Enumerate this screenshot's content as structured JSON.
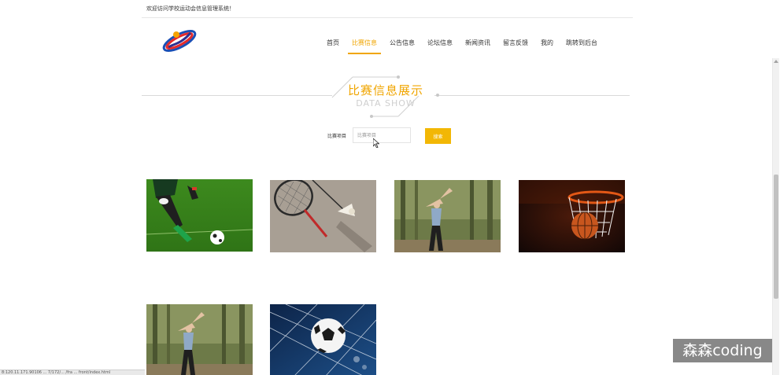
{
  "header": {
    "welcome_text": "欢迎访问学校运动会信息管理系统！"
  },
  "nav": {
    "items": [
      {
        "label": "首页"
      },
      {
        "label": "比赛信息",
        "active": true
      },
      {
        "label": "公告信息"
      },
      {
        "label": "论坛信息"
      },
      {
        "label": "新闻资讯"
      },
      {
        "label": "留言反馈"
      },
      {
        "label": "我的"
      },
      {
        "label": "跳转到后台"
      }
    ],
    "accent_color": "#f0a500"
  },
  "section": {
    "title_cn": "比赛信息展示",
    "title_en": "DATA SHOW"
  },
  "search": {
    "label": "比赛项目",
    "placeholder": "比赛项目",
    "button_label": "搜索",
    "button_color": "#f2b705"
  },
  "cards": [
    {
      "image": "soccer-kick-photo"
    },
    {
      "image": "badminton-racket-photo"
    },
    {
      "image": "woman-stretching-forest-photo"
    },
    {
      "image": "basketball-hoop-photo"
    },
    {
      "image": "woman-stretching-forest-photo"
    },
    {
      "image": "soccer-ball-net-photo"
    }
  ],
  "status_bar": {
    "text": "8:120.11.171.90106   ... 7/172/... /fra ... front/index.html"
  },
  "watermark": {
    "text": "森森coding"
  }
}
